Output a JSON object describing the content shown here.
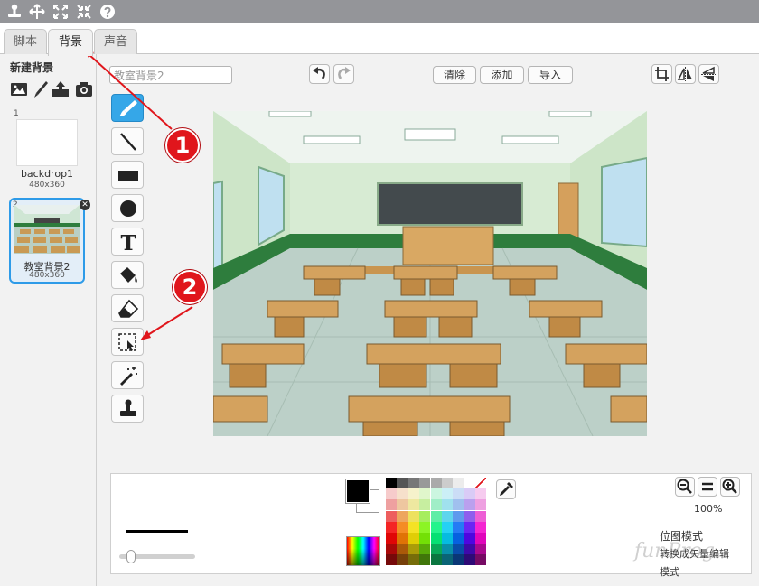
{
  "toolbar": {
    "icons": [
      "stamp-icon",
      "grow-icon",
      "expand-icon",
      "shrink-icon",
      "help-icon"
    ]
  },
  "tabs": [
    {
      "label": "脚本",
      "active": false
    },
    {
      "label": "背景",
      "active": true
    },
    {
      "label": "声音",
      "active": false
    }
  ],
  "sidebar": {
    "new_backdrop_label": "新建背景",
    "new_icons": [
      "image-library-icon",
      "paint-brush-icon",
      "upload-icon",
      "camera-icon"
    ],
    "backdrops": [
      {
        "number": "1",
        "name": "backdrop1",
        "size": "480x360"
      },
      {
        "number": "2",
        "name": "教室背景2",
        "size": "480x360"
      }
    ],
    "delete_glyph": "✕"
  },
  "editor": {
    "name_value": "教室背景2",
    "undo_icon": "undo-icon",
    "redo_icon": "redo-icon",
    "clear_label": "清除",
    "add_label": "添加",
    "import_label": "导入",
    "right_icons": [
      "crop-icon",
      "flip-horizontal-icon",
      "flip-vertical-icon"
    ],
    "tools": [
      "brush-icon",
      "line-icon",
      "rectangle-icon",
      "ellipse-icon",
      "text-icon",
      "fill-icon",
      "eraser-icon",
      "select-icon",
      "magic-wand-icon",
      "stamp-icon"
    ],
    "text_tool_glyph": "T",
    "selected_tool": "brush-icon"
  },
  "bottom": {
    "zoom_level": "100%",
    "mode_label": "位图模式",
    "convert_label": "转换成矢量编辑模式",
    "primary_color": "#000000",
    "secondary_color": "#ffffff"
  },
  "annotations": [
    "1",
    "2"
  ],
  "watermark": "funProg",
  "colors": {
    "accent": "#35a7e8",
    "selection_border": "#2e9be8",
    "annotation": "#e0161c",
    "topbar": "#949599"
  }
}
